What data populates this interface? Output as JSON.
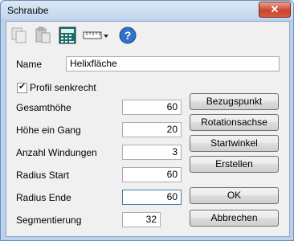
{
  "window": {
    "title": "Schraube",
    "close_glyph": "✕"
  },
  "toolbar": {
    "icons": [
      "copy-icon",
      "paste-icon",
      "calculator-icon",
      "ruler-dropdown-icon",
      "help-icon"
    ],
    "help_glyph": "?"
  },
  "name": {
    "label": "Name",
    "value": "Helixfläche"
  },
  "profil": {
    "label": "Profil senkrecht",
    "checked": true
  },
  "fields": [
    {
      "label": "Gesamthöhe",
      "value": "60"
    },
    {
      "label": "Höhe ein Gang",
      "value": "20"
    },
    {
      "label": "Anzahl Windungen",
      "value": "3"
    },
    {
      "label": "Radius Start",
      "value": "60"
    },
    {
      "label": "Radius Ende",
      "value": "60"
    },
    {
      "label": "Segmentierung",
      "value": "32"
    }
  ],
  "buttons": {
    "bezugspunkt": "Bezugspunkt",
    "rotationsachse": "Rotationsachse",
    "startwinkel": "Startwinkel",
    "erstellen": "Erstellen",
    "ok": "OK",
    "abbrechen": "Abbrechen"
  }
}
